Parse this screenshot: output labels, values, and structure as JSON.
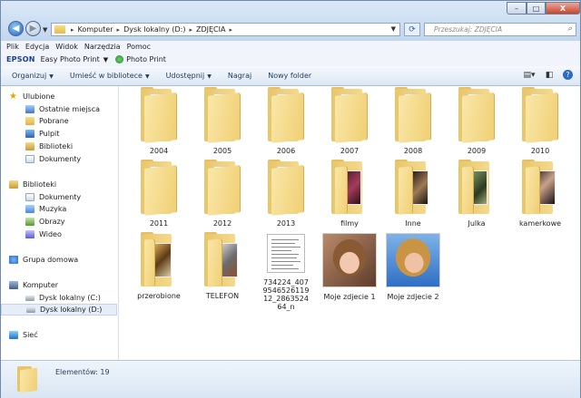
{
  "address": {
    "breadcrumbs": [
      "Komputer",
      "Dysk lokalny (D:)",
      "ZDJĘCIA"
    ],
    "search_placeholder": "Przeszukaj: ZDJĘCIA"
  },
  "window_controls": {
    "minimize": "–",
    "maximize": "□",
    "close": "X"
  },
  "menu": [
    "Plik",
    "Edycja",
    "Widok",
    "Narzędzia",
    "Pomoc"
  ],
  "epson": {
    "brand": "EPSON",
    "easy": "Easy Photo Print",
    "photo": "Photo Print"
  },
  "commands": [
    "Organizuj",
    "Umieść w bibliotece",
    "Udostępnij",
    "Nagraj",
    "Nowy folder"
  ],
  "nav": {
    "favorites": {
      "title": "Ulubione",
      "items": [
        "Ostatnie miejsca",
        "Pobrane",
        "Pulpit",
        "Biblioteki",
        "Dokumenty"
      ]
    },
    "libraries": {
      "title": "Biblioteki",
      "items": [
        "Dokumenty",
        "Muzyka",
        "Obrazy",
        "Wideo"
      ]
    },
    "homegroup": "Grupa domowa",
    "computer": {
      "title": "Komputer",
      "items": [
        "Dysk lokalny (C:)",
        "Dysk lokalny (D:)"
      ]
    },
    "network": "Sieć"
  },
  "items": [
    {
      "label": "2004",
      "kind": "folder"
    },
    {
      "label": "2005",
      "kind": "folder"
    },
    {
      "label": "2006",
      "kind": "folder"
    },
    {
      "label": "2007",
      "kind": "folder"
    },
    {
      "label": "2008",
      "kind": "folder"
    },
    {
      "label": "2009",
      "kind": "folder"
    },
    {
      "label": "2010",
      "kind": "folder"
    },
    {
      "label": "2011",
      "kind": "folder"
    },
    {
      "label": "2012",
      "kind": "folder"
    },
    {
      "label": "2013",
      "kind": "folder"
    },
    {
      "label": "filmy",
      "kind": "folder-photos"
    },
    {
      "label": "Inne",
      "kind": "folder-photos"
    },
    {
      "label": "Julka",
      "kind": "folder-photos"
    },
    {
      "label": "kamerkowe",
      "kind": "folder-photos"
    },
    {
      "label": "przerobione",
      "kind": "folder-photos"
    },
    {
      "label": "TELEFON",
      "kind": "folder-photos"
    },
    {
      "label": "734224_407954652611912_286352464_n",
      "kind": "document"
    },
    {
      "label": "Moje zdjecie 1",
      "kind": "photo"
    },
    {
      "label": "Moje zdjecie 2",
      "kind": "photo"
    }
  ],
  "details": {
    "count": "Elementów: 19"
  }
}
